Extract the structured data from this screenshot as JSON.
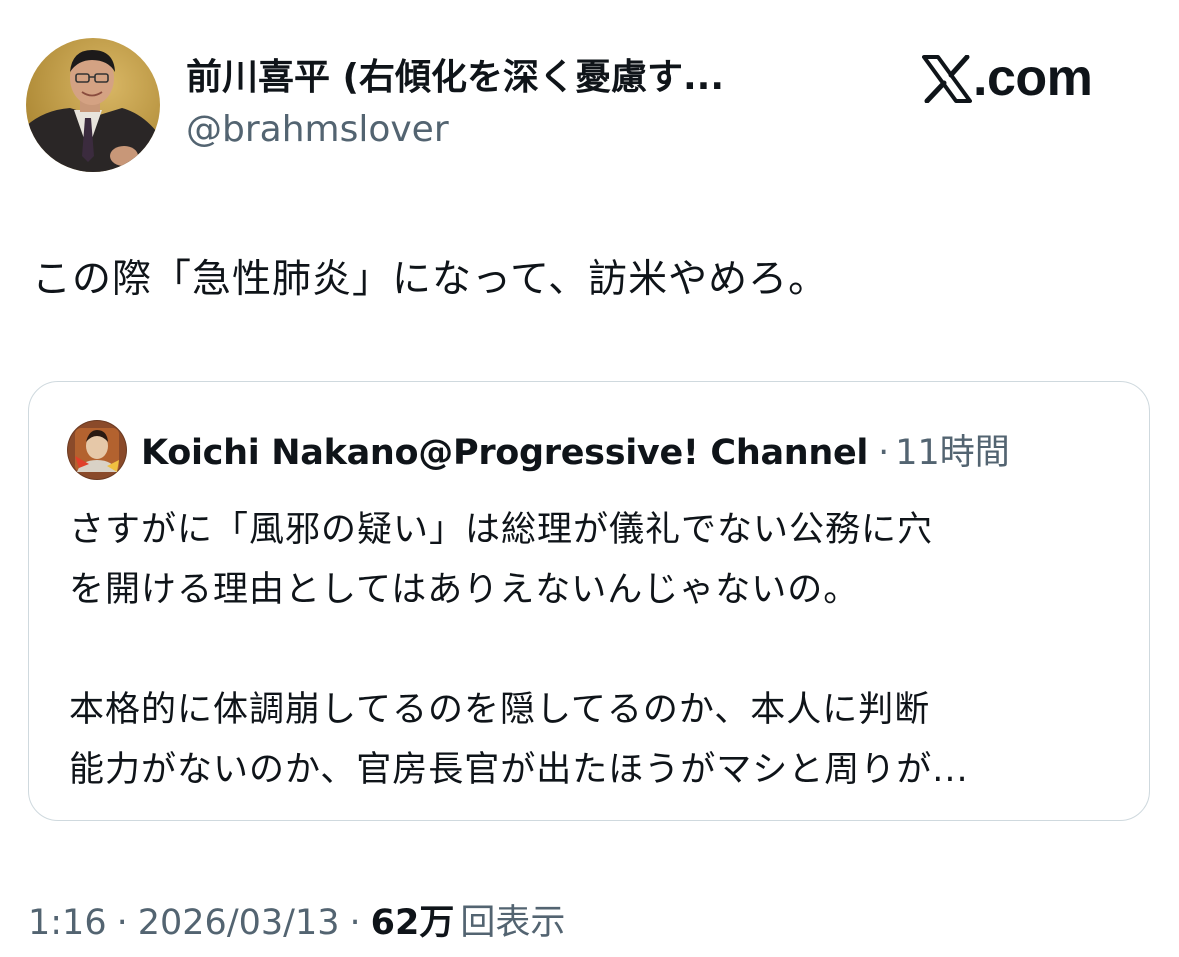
{
  "tweet": {
    "author": {
      "name": "前川喜平 (右傾化を深く憂慮す...",
      "handle": "@brahmslover",
      "avatar_icon": "portrait-avatar-icon"
    },
    "brand": {
      "logo_icon": "x-logo-icon",
      "text": ".com"
    },
    "text": "この際「急性肺炎」になって、訪米やめろ。",
    "quoted": {
      "author_name": "Koichi Nakano@Progressive! Channel",
      "separator": "·",
      "time": "11時間",
      "avatar_icon": "channel-avatar-icon",
      "lines": [
        "さすがに「風邪の疑い」は総理が儀礼でない公務に穴",
        "を開ける理由としてはありえないんじゃないの。",
        "",
        "本格的に体調崩してるのを隠してるのか、本人に判断",
        "能力がないのか、官房長官が出たほうがマシと周りが..."
      ]
    },
    "meta": {
      "time": "1:16",
      "sep1": "·",
      "date": "2026/03/13",
      "sep2": "·",
      "views_count": "62万",
      "views_label": "回表示"
    }
  },
  "colors": {
    "text_primary": "#0f1419",
    "text_secondary": "#536471",
    "border": "#cfd9de",
    "background": "#ffffff"
  }
}
